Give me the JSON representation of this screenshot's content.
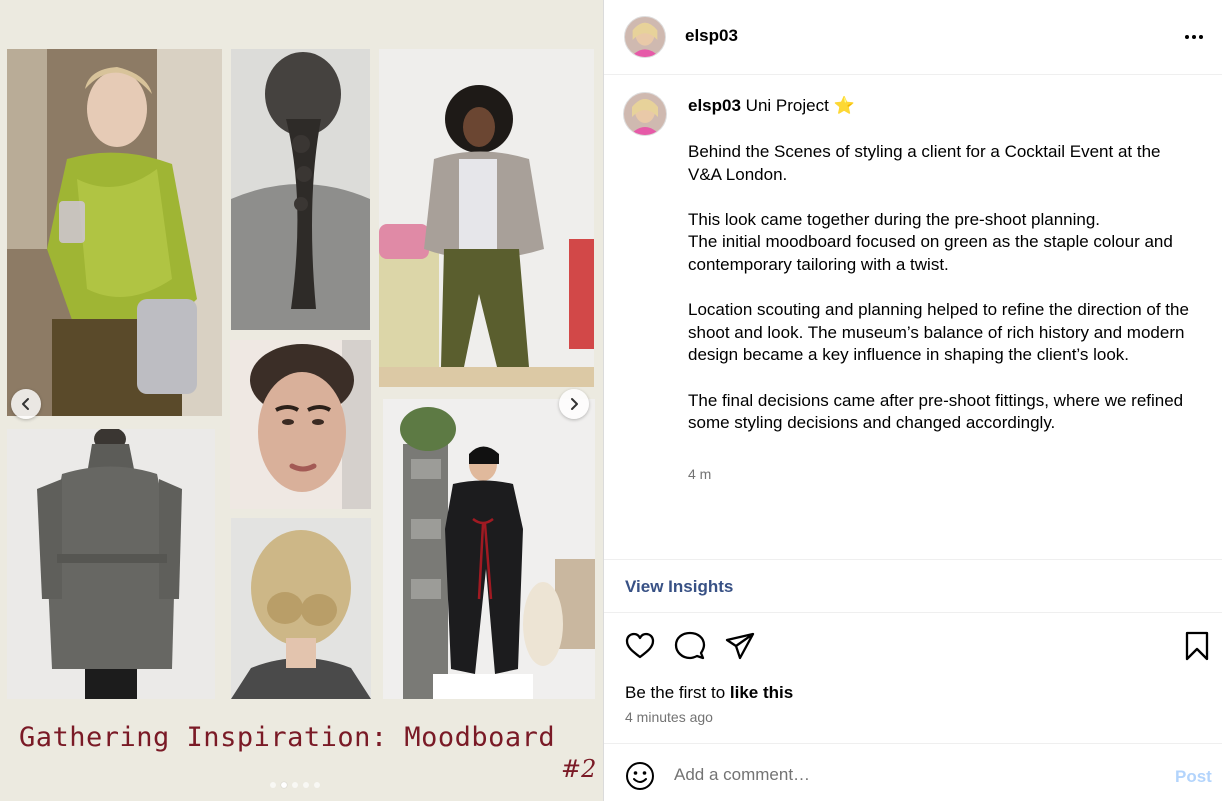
{
  "post": {
    "username": "elsp03",
    "more_icon": "more-horizontal-icon",
    "caption": {
      "username": "elsp03",
      "title": "Uni Project",
      "emoji": "⭐",
      "paragraphs": [
        "Behind the Scenes of styling a client for a Cocktail Event at the V&A London.",
        "This look came together during the pre-shoot planning.\nThe initial moodboard focused on green as the staple colour and contemporary tailoring with a twist.",
        "Location scouting and planning helped to refine the direction of the shoot and look. The museum’s balance of rich history and modern design became a key influence in shaping the client’s look.",
        "The final decisions came after pre-shoot fittings, where we refined some styling decisions and changed accordingly."
      ],
      "time": "4 m"
    },
    "insights_label": "View Insights",
    "likes_prefix": "Be the first to ",
    "likes_action": "like this",
    "posted_ago": "4 minutes ago",
    "comment_placeholder": "Add a comment…",
    "post_label": "Post",
    "icons": {
      "like": "heart-icon",
      "comment": "comment-icon",
      "share": "share-icon",
      "save": "bookmark-icon",
      "emoji": "emoji-icon"
    }
  },
  "slide": {
    "caption": "Gathering Inspiration: Moodboard",
    "number": "#2",
    "dots_total": 5,
    "dots_active": 1,
    "accent": "#7a1a26",
    "background": "#eceae0"
  },
  "colors": {
    "link": "#385185",
    "post_disabled": "#b3d4fc",
    "muted": "#737373"
  }
}
